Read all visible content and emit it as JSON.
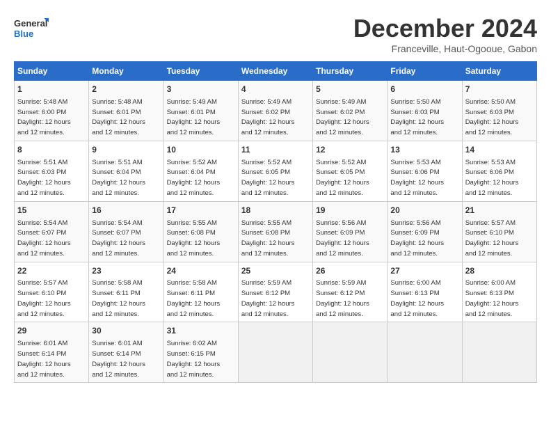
{
  "logo": {
    "line1": "General",
    "line2": "Blue"
  },
  "title": "December 2024",
  "subtitle": "Franceville, Haut-Ogooue, Gabon",
  "days_of_week": [
    "Sunday",
    "Monday",
    "Tuesday",
    "Wednesday",
    "Thursday",
    "Friday",
    "Saturday"
  ],
  "weeks": [
    [
      {
        "day": "1",
        "info": "Sunrise: 5:48 AM\nSunset: 6:00 PM\nDaylight: 12 hours\nand 12 minutes."
      },
      {
        "day": "2",
        "info": "Sunrise: 5:48 AM\nSunset: 6:01 PM\nDaylight: 12 hours\nand 12 minutes."
      },
      {
        "day": "3",
        "info": "Sunrise: 5:49 AM\nSunset: 6:01 PM\nDaylight: 12 hours\nand 12 minutes."
      },
      {
        "day": "4",
        "info": "Sunrise: 5:49 AM\nSunset: 6:02 PM\nDaylight: 12 hours\nand 12 minutes."
      },
      {
        "day": "5",
        "info": "Sunrise: 5:49 AM\nSunset: 6:02 PM\nDaylight: 12 hours\nand 12 minutes."
      },
      {
        "day": "6",
        "info": "Sunrise: 5:50 AM\nSunset: 6:03 PM\nDaylight: 12 hours\nand 12 minutes."
      },
      {
        "day": "7",
        "info": "Sunrise: 5:50 AM\nSunset: 6:03 PM\nDaylight: 12 hours\nand 12 minutes."
      }
    ],
    [
      {
        "day": "8",
        "info": "Sunrise: 5:51 AM\nSunset: 6:03 PM\nDaylight: 12 hours\nand 12 minutes."
      },
      {
        "day": "9",
        "info": "Sunrise: 5:51 AM\nSunset: 6:04 PM\nDaylight: 12 hours\nand 12 minutes."
      },
      {
        "day": "10",
        "info": "Sunrise: 5:52 AM\nSunset: 6:04 PM\nDaylight: 12 hours\nand 12 minutes."
      },
      {
        "day": "11",
        "info": "Sunrise: 5:52 AM\nSunset: 6:05 PM\nDaylight: 12 hours\nand 12 minutes."
      },
      {
        "day": "12",
        "info": "Sunrise: 5:52 AM\nSunset: 6:05 PM\nDaylight: 12 hours\nand 12 minutes."
      },
      {
        "day": "13",
        "info": "Sunrise: 5:53 AM\nSunset: 6:06 PM\nDaylight: 12 hours\nand 12 minutes."
      },
      {
        "day": "14",
        "info": "Sunrise: 5:53 AM\nSunset: 6:06 PM\nDaylight: 12 hours\nand 12 minutes."
      }
    ],
    [
      {
        "day": "15",
        "info": "Sunrise: 5:54 AM\nSunset: 6:07 PM\nDaylight: 12 hours\nand 12 minutes."
      },
      {
        "day": "16",
        "info": "Sunrise: 5:54 AM\nSunset: 6:07 PM\nDaylight: 12 hours\nand 12 minutes."
      },
      {
        "day": "17",
        "info": "Sunrise: 5:55 AM\nSunset: 6:08 PM\nDaylight: 12 hours\nand 12 minutes."
      },
      {
        "day": "18",
        "info": "Sunrise: 5:55 AM\nSunset: 6:08 PM\nDaylight: 12 hours\nand 12 minutes."
      },
      {
        "day": "19",
        "info": "Sunrise: 5:56 AM\nSunset: 6:09 PM\nDaylight: 12 hours\nand 12 minutes."
      },
      {
        "day": "20",
        "info": "Sunrise: 5:56 AM\nSunset: 6:09 PM\nDaylight: 12 hours\nand 12 minutes."
      },
      {
        "day": "21",
        "info": "Sunrise: 5:57 AM\nSunset: 6:10 PM\nDaylight: 12 hours\nand 12 minutes."
      }
    ],
    [
      {
        "day": "22",
        "info": "Sunrise: 5:57 AM\nSunset: 6:10 PM\nDaylight: 12 hours\nand 12 minutes."
      },
      {
        "day": "23",
        "info": "Sunrise: 5:58 AM\nSunset: 6:11 PM\nDaylight: 12 hours\nand 12 minutes."
      },
      {
        "day": "24",
        "info": "Sunrise: 5:58 AM\nSunset: 6:11 PM\nDaylight: 12 hours\nand 12 minutes."
      },
      {
        "day": "25",
        "info": "Sunrise: 5:59 AM\nSunset: 6:12 PM\nDaylight: 12 hours\nand 12 minutes."
      },
      {
        "day": "26",
        "info": "Sunrise: 5:59 AM\nSunset: 6:12 PM\nDaylight: 12 hours\nand 12 minutes."
      },
      {
        "day": "27",
        "info": "Sunrise: 6:00 AM\nSunset: 6:13 PM\nDaylight: 12 hours\nand 12 minutes."
      },
      {
        "day": "28",
        "info": "Sunrise: 6:00 AM\nSunset: 6:13 PM\nDaylight: 12 hours\nand 12 minutes."
      }
    ],
    [
      {
        "day": "29",
        "info": "Sunrise: 6:01 AM\nSunset: 6:14 PM\nDaylight: 12 hours\nand 12 minutes."
      },
      {
        "day": "30",
        "info": "Sunrise: 6:01 AM\nSunset: 6:14 PM\nDaylight: 12 hours\nand 12 minutes."
      },
      {
        "day": "31",
        "info": "Sunrise: 6:02 AM\nSunset: 6:15 PM\nDaylight: 12 hours\nand 12 minutes."
      },
      {
        "day": "",
        "info": ""
      },
      {
        "day": "",
        "info": ""
      },
      {
        "day": "",
        "info": ""
      },
      {
        "day": "",
        "info": ""
      }
    ]
  ]
}
